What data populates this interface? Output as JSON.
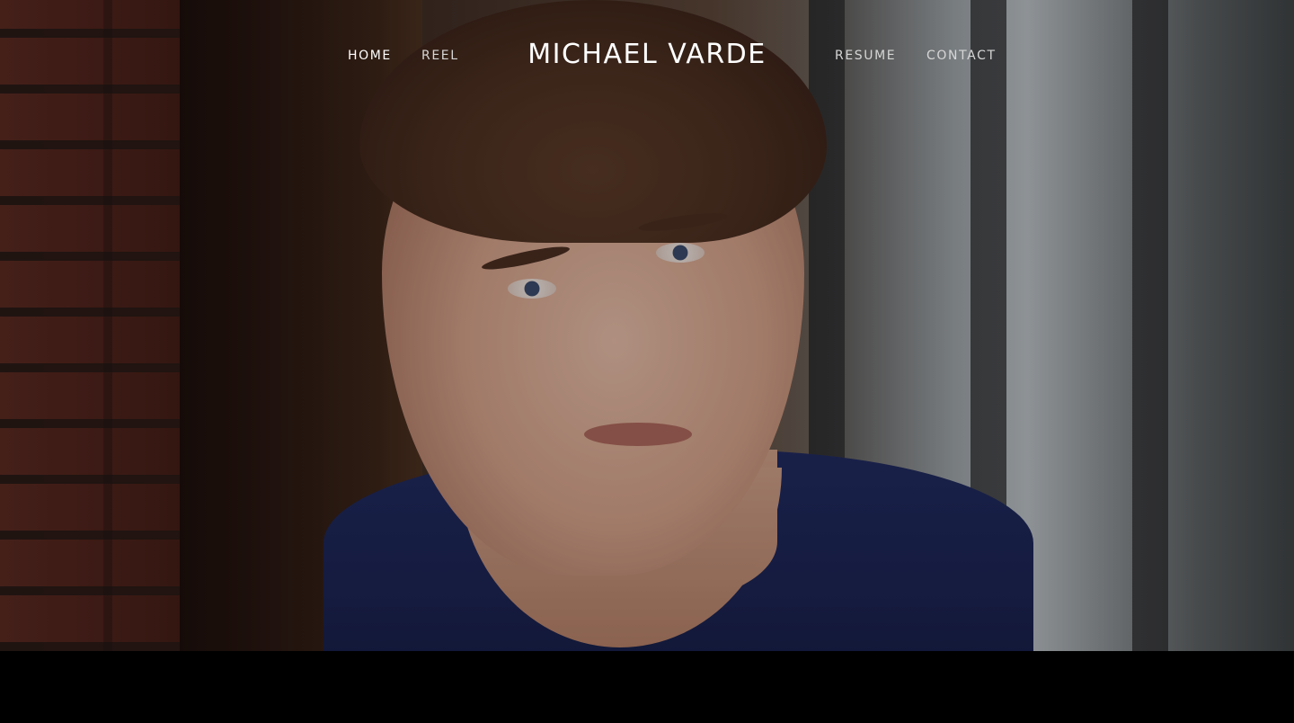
{
  "site": {
    "title": "MICHAEL VARDE"
  },
  "nav": {
    "home": "HOME",
    "reel": "REEL",
    "resume": "RESUME",
    "contact": "CONTACT"
  },
  "hero": {
    "image": "headshot-photo"
  }
}
